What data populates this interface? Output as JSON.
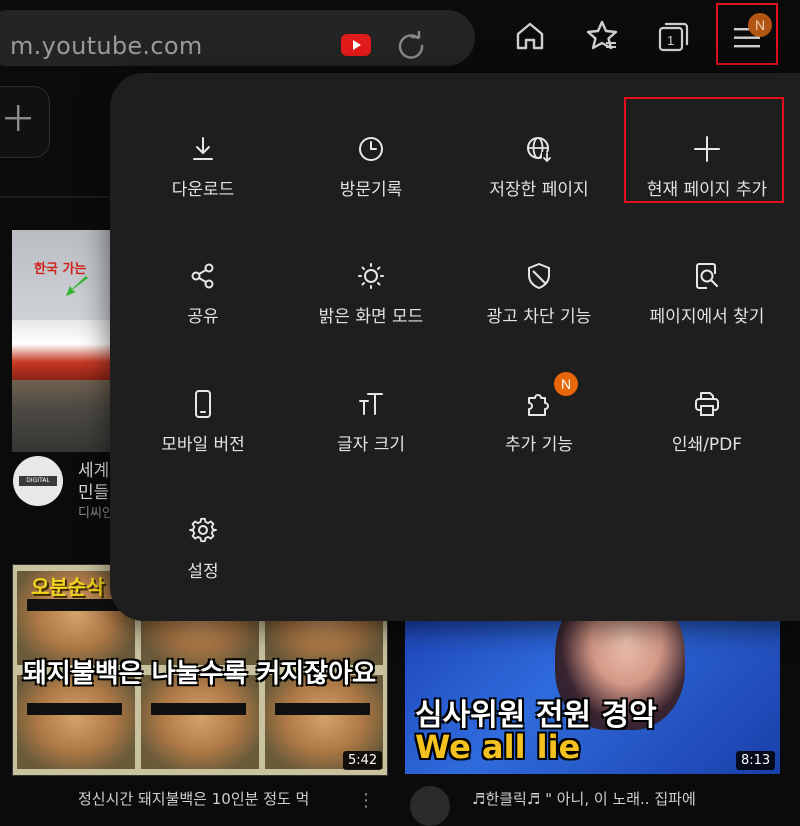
{
  "browser": {
    "url": "m.youtube.com",
    "menu_badge": "N"
  },
  "background": {
    "video1": {
      "thumbnail_text": "한국 가는",
      "avatar_text": "DIGITAL",
      "title_line1": "세계(",
      "title_line2": "민들(",
      "channel": "디씨인"
    },
    "video2": {
      "logo_text": "오분순삭",
      "caption": "돼지불백은 나눌수록 커지잖아요",
      "duration": "5:42",
      "title": "정신시간 돼지불백은 10인분 정도 먹"
    },
    "video3": {
      "caption_line1": "심사위원 전원 경악",
      "caption_line2": "We all lie",
      "duration": "8:13",
      "title": "♬한클릭♬ \" 아니, 이 노래.. 집파에"
    }
  },
  "quick_menu": {
    "items": [
      {
        "label": "다운로드",
        "icon": "download-icon"
      },
      {
        "label": "방문기록",
        "icon": "history-clock-icon"
      },
      {
        "label": "저장한 페이지",
        "icon": "saved-pages-globe-icon"
      },
      {
        "label": "현재 페이지 추가",
        "icon": "plus-icon"
      },
      {
        "label": "공유",
        "icon": "share-icon"
      },
      {
        "label": "밝은 화면 모드",
        "icon": "sun-icon"
      },
      {
        "label": "광고 차단 기능",
        "icon": "shield-icon"
      },
      {
        "label": "페이지에서 찾기",
        "icon": "find-in-page-icon"
      },
      {
        "label": "모바일 버전",
        "icon": "mobile-phone-icon"
      },
      {
        "label": "글자 크기",
        "icon": "text-size-icon"
      },
      {
        "label": "추가 기능",
        "icon": "puzzle-icon",
        "badge": "N"
      },
      {
        "label": "인쇄/PDF",
        "icon": "printer-icon"
      },
      {
        "label": "설정",
        "icon": "gear-icon"
      }
    ]
  },
  "colors": {
    "highlight": "#e0101e",
    "badge": "#e8650a",
    "menu_bg": "#1e1e1e"
  }
}
